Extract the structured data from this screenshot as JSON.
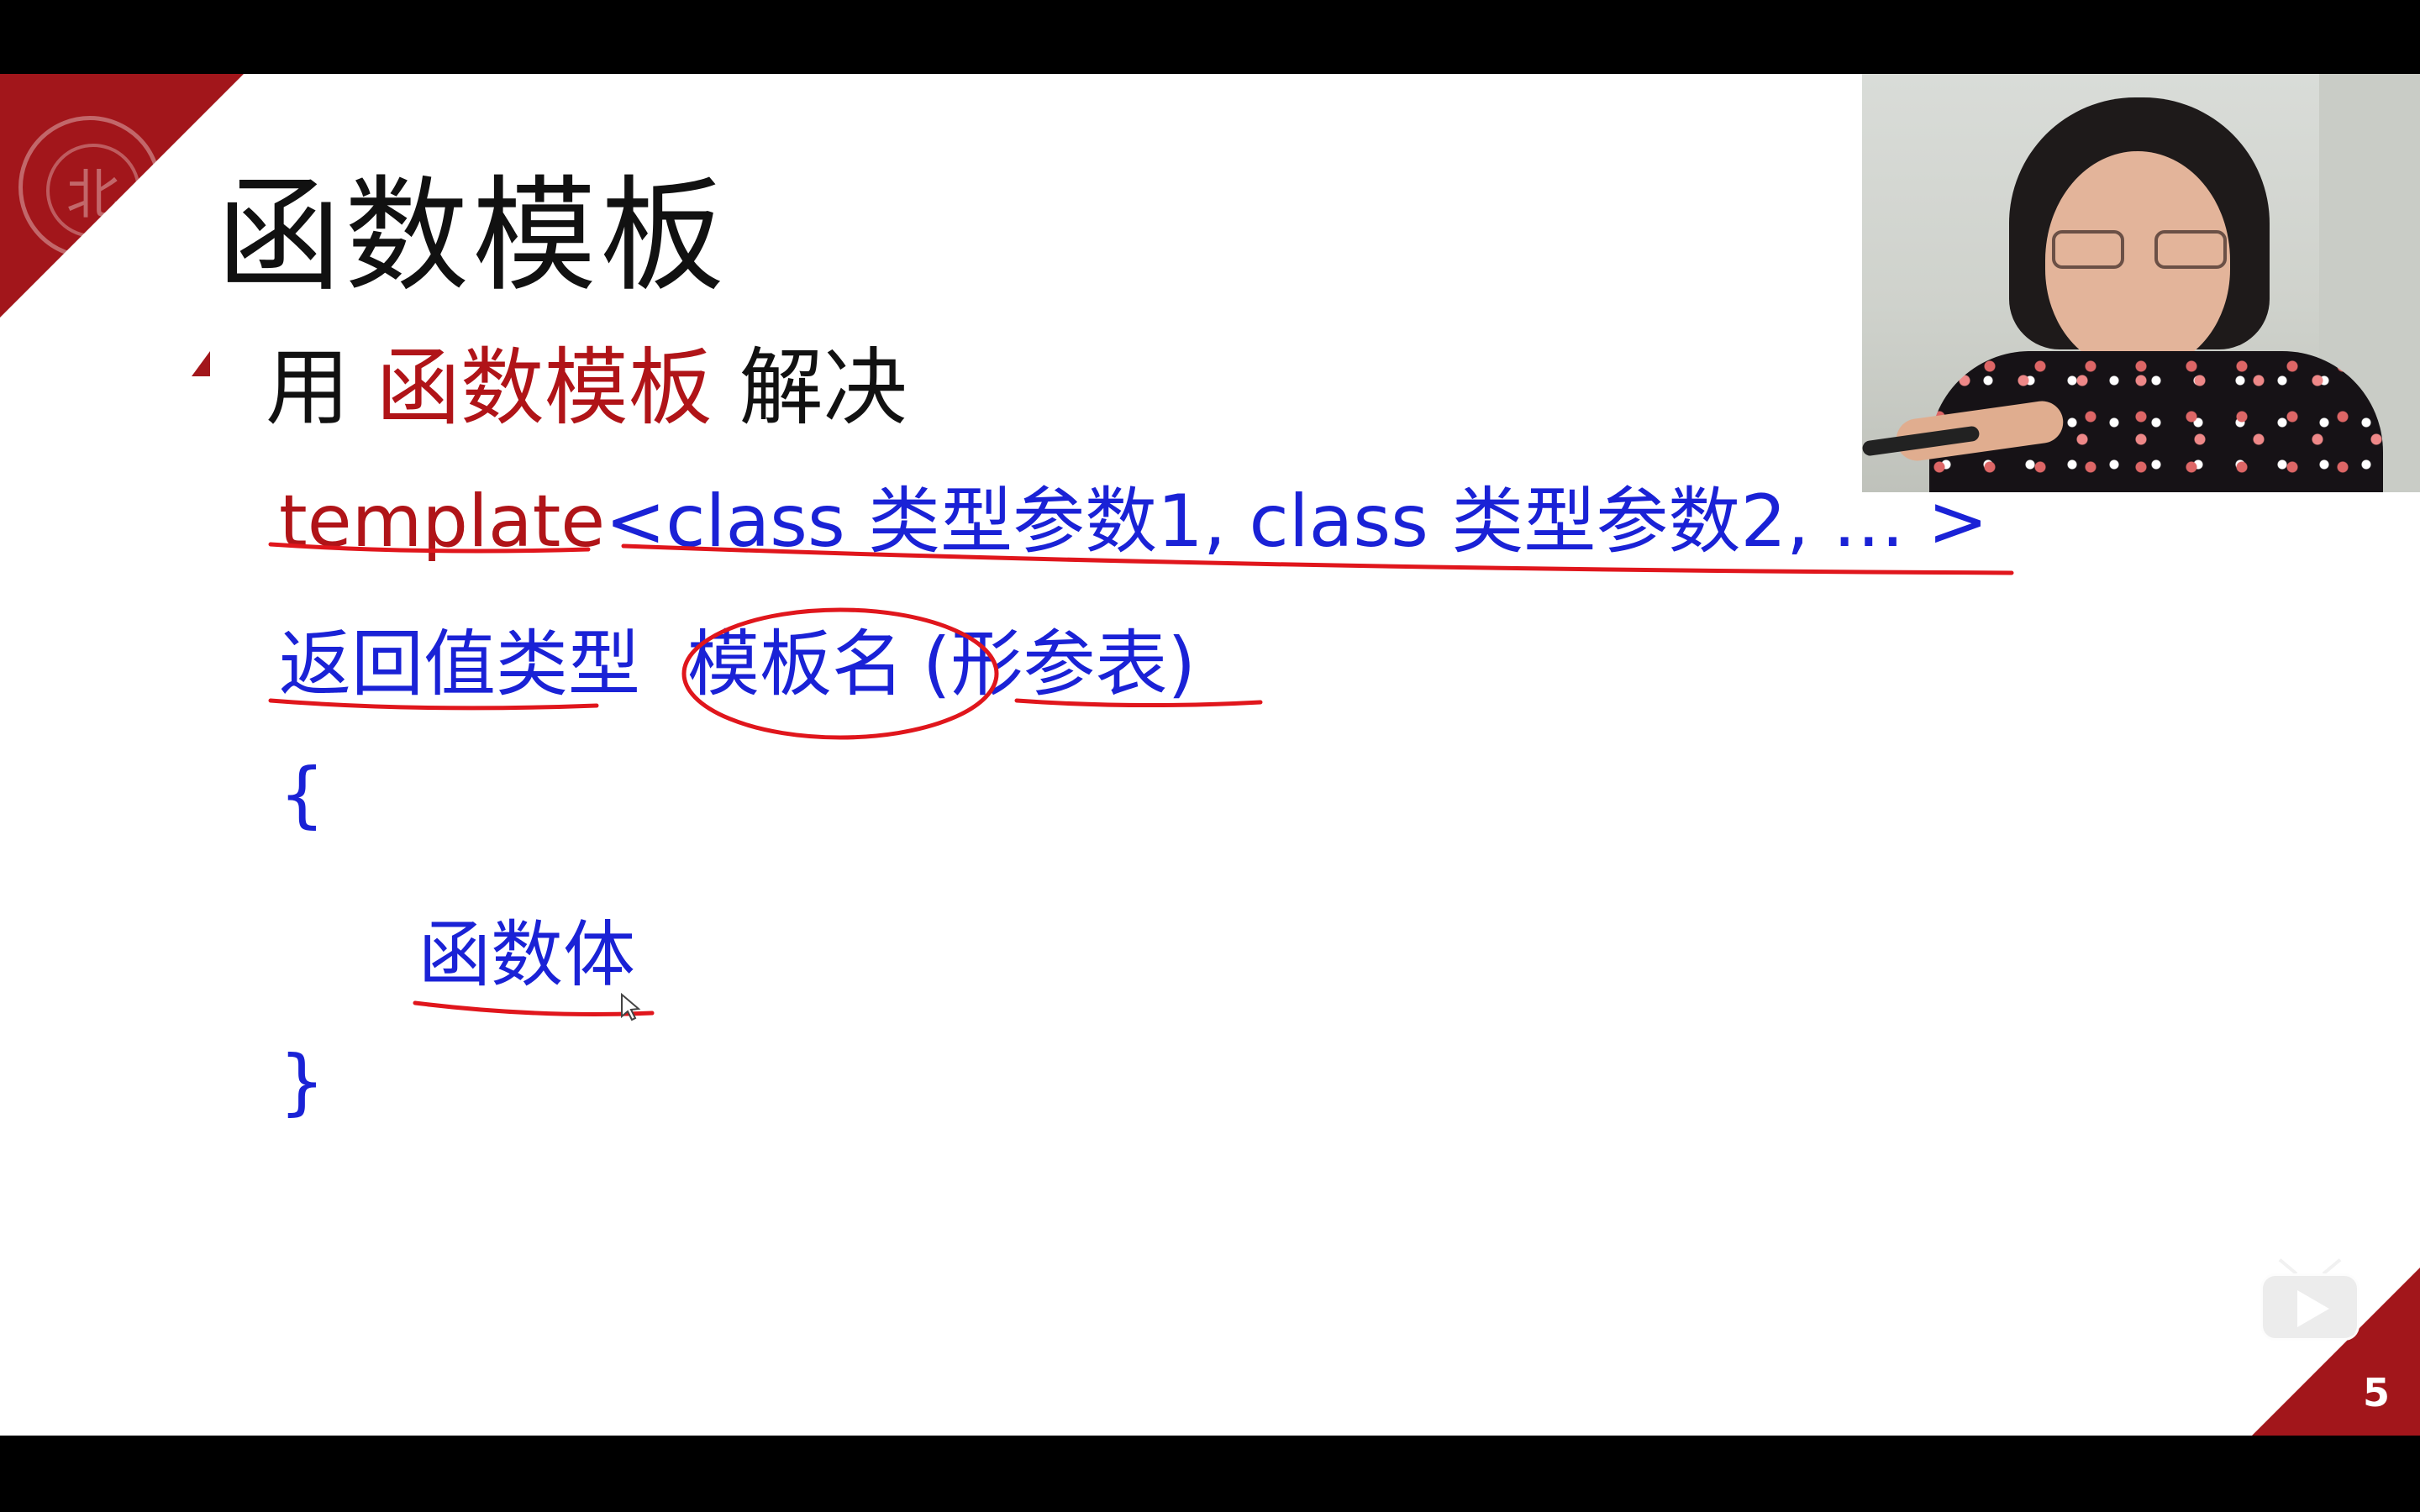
{
  "slide": {
    "title": "函数模板",
    "page_number": "5",
    "bullet": {
      "prefix": "用",
      "highlight": "函数模板",
      "suffix": "解决"
    },
    "code": {
      "template_keyword": "template",
      "template_params": "<class 类型参数1, class 类型参数2, … >",
      "return_type": "返回值类型",
      "template_name": "模板名",
      "param_list": "(形参表)",
      "open_brace": "{",
      "body": "函数体",
      "close_brace": "}"
    }
  },
  "colors": {
    "accent_red": "#a2161b",
    "code_blue": "#1a22d6",
    "annotation_red": "#e0161c"
  },
  "icons": {
    "logo": "university-seal-icon",
    "play": "play-badge-icon"
  }
}
